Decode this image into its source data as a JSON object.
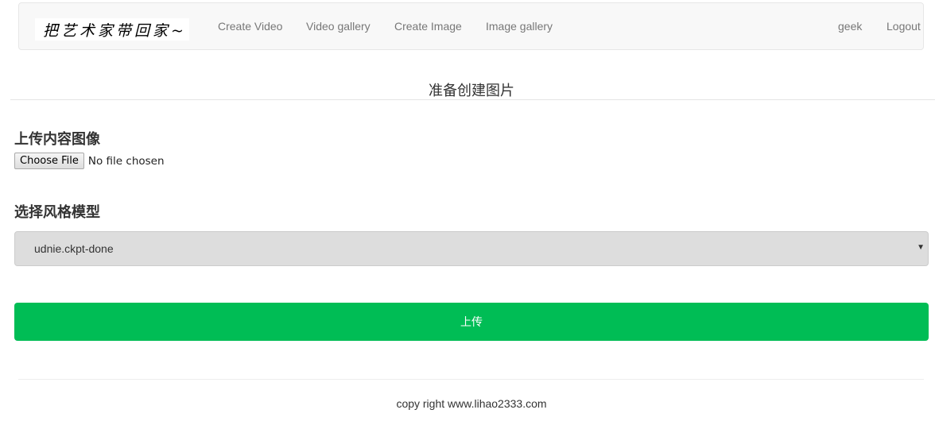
{
  "navbar": {
    "brand": "把艺术家带回家~",
    "links": [
      "Create Video",
      "Video gallery",
      "Create Image",
      "Image gallery"
    ],
    "user": "geek",
    "logout": "Logout"
  },
  "page": {
    "heading": "准备创建图片"
  },
  "upload": {
    "label": "上传内容图像",
    "button_label": "Choose File",
    "status": "No file chosen"
  },
  "style_model": {
    "label": "选择风格模型",
    "selected": "udnie.ckpt-done"
  },
  "submit": {
    "label": "上传",
    "color": "#00bd55"
  },
  "footer": {
    "text": "copy right www.lihao2333.com"
  }
}
